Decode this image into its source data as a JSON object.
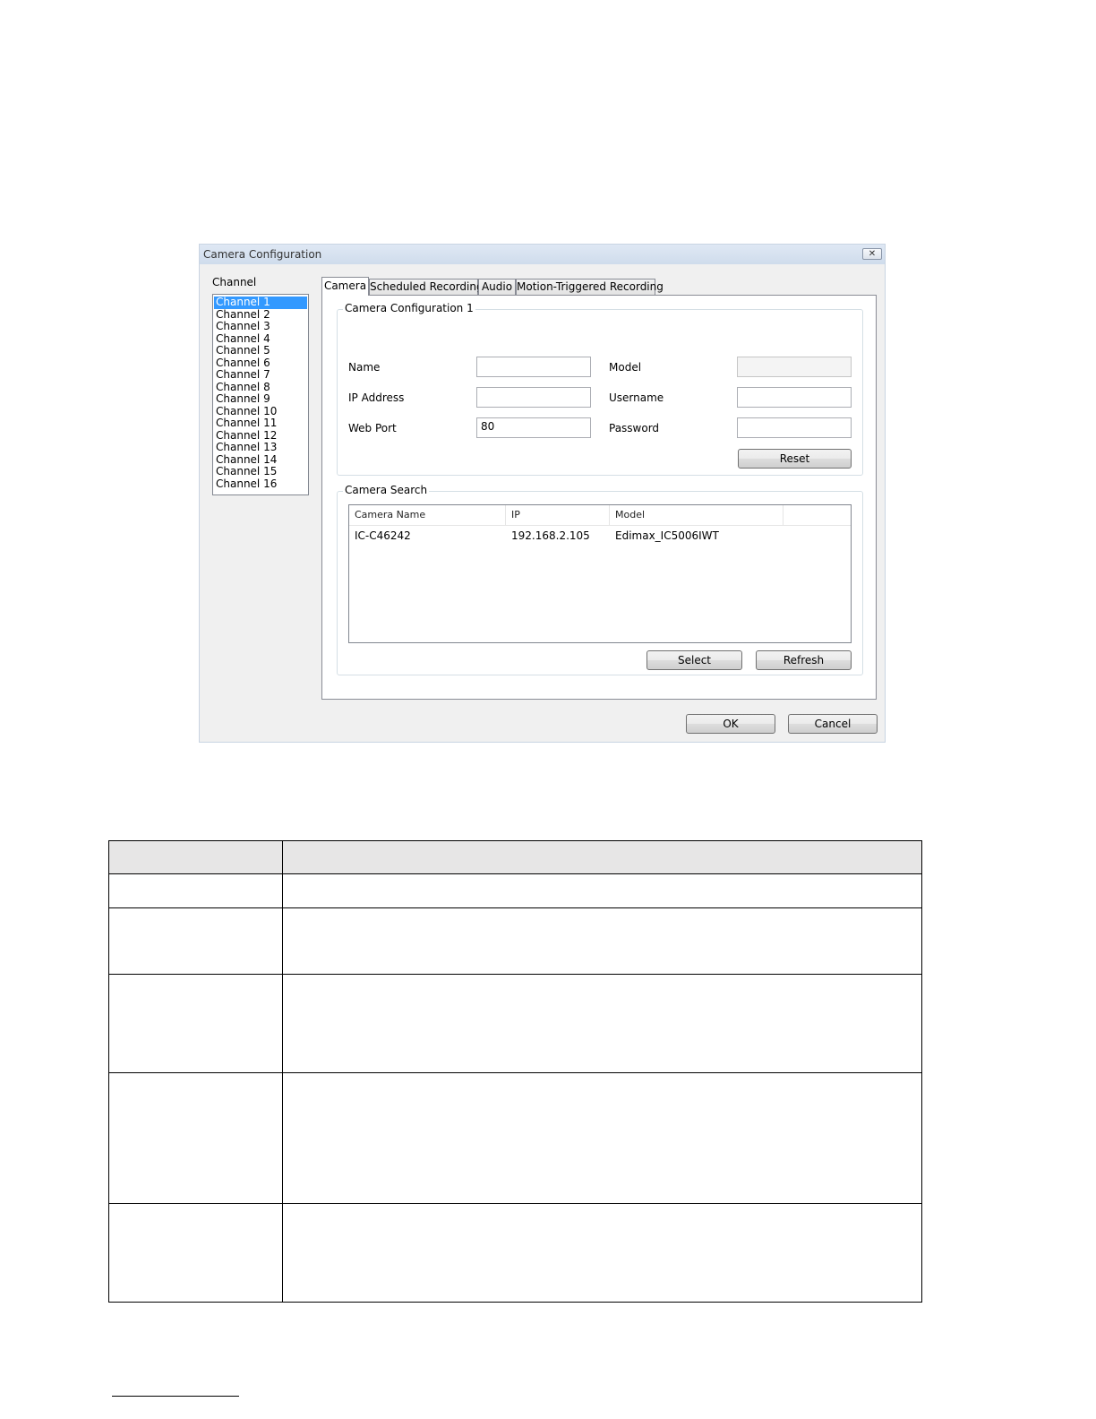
{
  "dialog": {
    "title": "Camera Configuration",
    "close_glyph": "✕",
    "channel_label": "Channel",
    "channels": [
      "Channel 1",
      "Channel 2",
      "Channel 3",
      "Channel 4",
      "Channel 5",
      "Channel 6",
      "Channel 7",
      "Channel 8",
      "Channel 9",
      "Channel 10",
      "Channel 11",
      "Channel 12",
      "Channel 13",
      "Channel 14",
      "Channel 15",
      "Channel 16"
    ],
    "selected_channel": "Channel 1",
    "tabs": [
      "Camera",
      "Scheduled Recording",
      "Audio",
      "Motion-Triggered Recording"
    ],
    "active_tab": "Camera",
    "config_group": {
      "title": "Camera Configuration 1",
      "name_label": "Name",
      "name_value": "",
      "ip_label": "IP Address",
      "ip_value": "",
      "port_label": "Web Port",
      "port_value": "80",
      "model_label": "Model",
      "model_value": "",
      "username_label": "Username",
      "username_value": "",
      "password_label": "Password",
      "password_value": "",
      "reset_label": "Reset"
    },
    "search_group": {
      "title": "Camera Search",
      "columns": [
        "Camera Name",
        "IP",
        "Model",
        ""
      ],
      "rows": [
        [
          "IC-C46242",
          "192.168.2.105",
          "Edimax_IC5006IWT"
        ]
      ],
      "select_label": "Select",
      "refresh_label": "Refresh"
    },
    "ok_label": "OK",
    "cancel_label": "Cancel"
  },
  "colors": {
    "selection": "#3399ff",
    "dialog_bg": "#f0f0f0",
    "table_header": "#e7e6e6"
  }
}
